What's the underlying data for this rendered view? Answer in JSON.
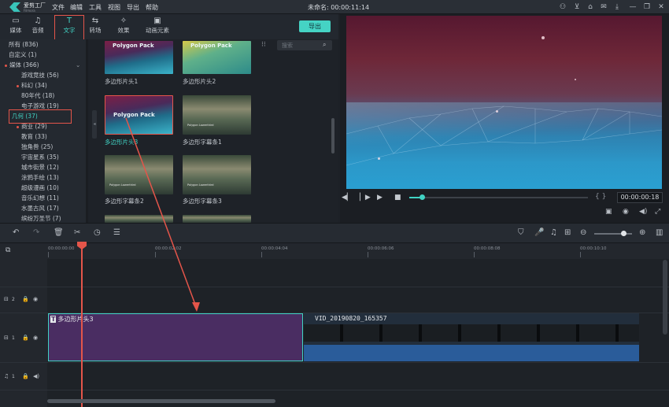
{
  "app": {
    "name": "爱剪工厂",
    "sub": "Filmora"
  },
  "menu": [
    "文件",
    "编辑",
    "工具",
    "视图",
    "导出",
    "帮助"
  ],
  "doc_title": "未命名: 00:00:11:14",
  "toolbar_tabs": [
    {
      "label": "媒体",
      "icon": "folder-icon"
    },
    {
      "label": "音频",
      "icon": "music-icon"
    },
    {
      "label": "文字",
      "icon": "text-icon"
    },
    {
      "label": "转场",
      "icon": "transition-icon"
    },
    {
      "label": "效果",
      "icon": "effects-icon"
    },
    {
      "label": "动画元素",
      "icon": "elements-icon"
    }
  ],
  "export_label": "导出",
  "categories": [
    {
      "label": "所有 (836)",
      "dot": false
    },
    {
      "label": "自定义 (1)",
      "dot": false
    },
    {
      "label": "媒体 (366)",
      "dot": true
    },
    {
      "label": "游戏竞技 (56)",
      "dot": false
    },
    {
      "label": "科幻 (34)",
      "dot": true
    },
    {
      "label": "80年代 (18)",
      "dot": false
    },
    {
      "label": "电子游戏 (19)",
      "dot": false
    },
    {
      "label": "几何 (37)",
      "dot": false
    },
    {
      "label": "商业 (29)",
      "dot": true
    },
    {
      "label": "教育 (33)",
      "dot": false
    },
    {
      "label": "独角兽 (25)",
      "dot": false
    },
    {
      "label": "宇宙星系 (35)",
      "dot": false
    },
    {
      "label": "城市街景 (12)",
      "dot": false
    },
    {
      "label": "涂鸦手绘 (13)",
      "dot": false
    },
    {
      "label": "超级漫画 (10)",
      "dot": false
    },
    {
      "label": "音乐幻想 (11)",
      "dot": false
    },
    {
      "label": "水墨古风 (17)",
      "dot": false
    },
    {
      "label": "缤纷万圣节 (7)",
      "dot": false
    }
  ],
  "search": {
    "placeholder": "搜索"
  },
  "thumbs": [
    {
      "caption": "多边形片头1",
      "overlay": "Polygon Pack"
    },
    {
      "caption": "多边形片头2",
      "overlay": "Polygon Pack"
    },
    {
      "caption": "多边形片头3",
      "overlay": "Polygon Pack"
    },
    {
      "caption": "多边形字幕条1",
      "overlay": "Polygon Lowerthird"
    },
    {
      "caption": "多边形字幕条2",
      "overlay": "Polygon Lowerthird"
    },
    {
      "caption": "多边形字幕条3",
      "overlay": "Polygon Lowerthird"
    }
  ],
  "player": {
    "timecode": "00:00:00:18",
    "progress": 0.06
  },
  "ruler": [
    "00:00:00:00",
    "00:00:02:02",
    "00:00:04:04",
    "00:00:06:06",
    "00:00:08:08",
    "00:00:10:10"
  ],
  "tracks": [
    {
      "label": "2"
    },
    {
      "label": "1"
    },
    {
      "label": "1"
    }
  ],
  "clips": {
    "title": "多边形片头3",
    "video": "VID_20190820_165357"
  },
  "colors": {
    "accent": "#41d3c4",
    "highlight": "#e4554a"
  }
}
